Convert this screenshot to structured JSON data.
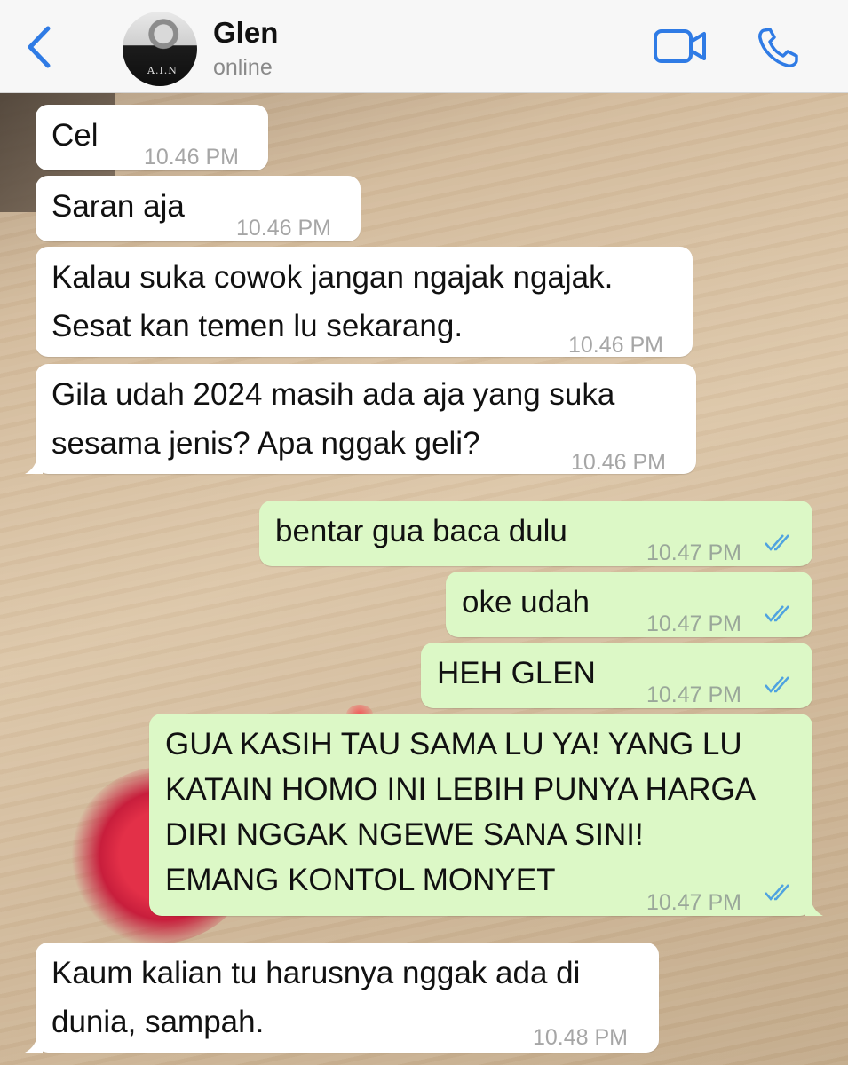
{
  "header": {
    "back_label": "",
    "contact_name": "Glen",
    "status": "online",
    "avatar_shirt_text": "A.I.N"
  },
  "icons": {
    "back": "chevron-left-icon",
    "video": "video-camera-icon",
    "call": "phone-icon",
    "read_receipt": "double-check-icon"
  },
  "colors": {
    "accent": "#2f7be5",
    "incoming_bubble": "#ffffff",
    "outgoing_bubble": "#dcf8c6",
    "read_tick": "#4fa3e0"
  },
  "messages": [
    {
      "dir": "in",
      "text": "Cel",
      "time": "10.46 PM"
    },
    {
      "dir": "in",
      "text": "Saran aja",
      "time": "10.46 PM"
    },
    {
      "dir": "in",
      "text": "Kalau suka cowok jangan ngajak ngajak.\nSesat kan temen lu sekarang.",
      "time": "10.46 PM"
    },
    {
      "dir": "in",
      "text": "Gila udah 2024 masih ada aja yang suka\nsesama jenis? Apa nggak geli?",
      "time": "10.46 PM"
    },
    {
      "dir": "out",
      "text": "bentar gua baca dulu",
      "time": "10.47 PM",
      "status": "read"
    },
    {
      "dir": "out",
      "text": "oke udah",
      "time": "10.47 PM",
      "status": "read"
    },
    {
      "dir": "out",
      "text": "HEH GLEN",
      "time": "10.47 PM",
      "status": "read"
    },
    {
      "dir": "out",
      "text": "GUA KASIH TAU SAMA LU YA! YANG LU\nKATAIN HOMO INI LEBIH PUNYA HARGA\nDIRI NGGAK NGEWE SANA SINI!\nEMANG KONTOL MONYET",
      "time": "10.47 PM",
      "status": "read"
    },
    {
      "dir": "in",
      "text": "Kaum kalian tu harusnya nggak ada di\ndunia, sampah.",
      "time": "10.48 PM"
    }
  ]
}
